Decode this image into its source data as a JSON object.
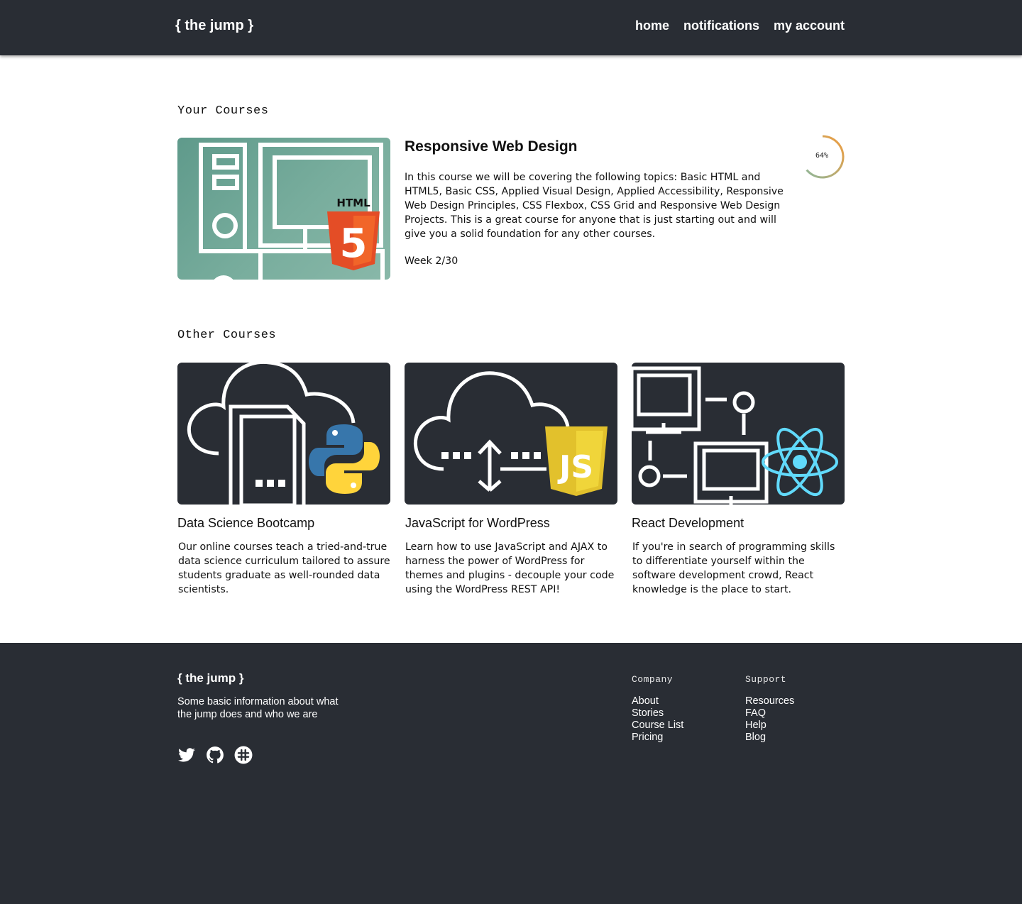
{
  "header": {
    "logo": "{ the jump }",
    "nav": [
      "home",
      "notifications",
      "my account"
    ]
  },
  "your_courses": {
    "heading": "Your Courses",
    "featured": {
      "title": "Responsive Web Design",
      "description": "In this course we will be covering the following topics: Basic HTML and HTML5, Basic CSS, Applied Visual Design, Applied Accessibility, Responsive Web Design Principles, CSS Flexbox, CSS Grid and Responsive Web Design Projects. This is a great course for anyone that is just starting out and will give you a solid foundation for any other courses.",
      "week": "Week 2/30",
      "progress_label": "64%",
      "progress_fraction": 0.64,
      "badge": "HTML",
      "badge_digit": "5",
      "icon": "html5-logo"
    }
  },
  "other_courses": {
    "heading": "Other Courses",
    "items": [
      {
        "title": "Data Science Bootcamp",
        "description": "Our online courses teach a tried-and-true data science curriculum tailored to assure students graduate as well-rounded data scientists.",
        "icon": "python-logo"
      },
      {
        "title": "JavaScript for WordPress",
        "description": "Learn how to use JavaScript and AJAX to harness the power of WordPress for themes and plugins - decouple your code using the WordPress REST API!",
        "icon": "js-logo",
        "badge": "JS"
      },
      {
        "title": "React Development",
        "description": "If you're in search of programming skills to differentiate yourself within the software development crowd, React knowledge is the place to start.",
        "icon": "react-logo"
      }
    ]
  },
  "footer": {
    "logo": "{ the jump }",
    "about": "Some basic information about what the jump does and who we are",
    "social": [
      "twitter-icon",
      "github-icon",
      "slack-icon"
    ],
    "company": {
      "heading": "Company",
      "links": [
        "About",
        "Stories",
        "Course List",
        "Pricing"
      ]
    },
    "support": {
      "heading": "Support",
      "links": [
        "Resources",
        "FAQ",
        "Help",
        "Blog"
      ]
    }
  },
  "colors": {
    "header_bg": "#292d34",
    "footer_bg": "#292d34",
    "featured_thumb": "#78ad9d",
    "html5_orange": "#e44d26",
    "js_yellow": "#e2c12c",
    "react_cyan": "#61dafb",
    "progress_start": "#8fb79a",
    "progress_end": "#f39c3c"
  }
}
